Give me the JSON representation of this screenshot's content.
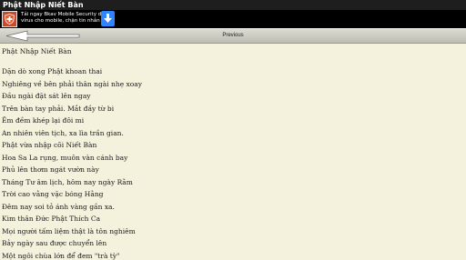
{
  "window": {
    "title": "Phật Nhập Niết Bàn"
  },
  "ad": {
    "icon": "shield-plus-icon",
    "text_line1": "Tải ngay Bkav Mobile Security diệt",
    "text_line2": "virus cho mobile, chặn tin nhắn rác",
    "download_icon": "download-arrow-icon"
  },
  "nav": {
    "back_icon": "back-arrow-icon",
    "previous_label": "Previous"
  },
  "document": {
    "title": "Phật Nhập Niết Bàn",
    "lines": [
      "Dặn dò xong Phật khoan thai",
      "Nghiêng về bên phải thân ngài nhẹ xoay",
      "Đầu ngài đặt sát lên ngay",
      "Trên bàn tay phải. Mắt đầy từ bi",
      "Êm đềm khép lại đôi mi",
      "An nhiên viên tịch, xa lìa trần gian.",
      "Phật vừa nhập cõi Niết Bàn",
      "Hoa Sa La rụng, muôn vàn cánh bay",
      "Phủ lên thơm ngát vườn này",
      "Tháng Tư âm lịch, hôm nay ngày Rằm",
      "Trời cao vằng vặc bóng Hằng",
      "Đêm nay soi tỏ ánh vàng gần xa.",
      "Kim thân Đức Phật Thích Ca",
      "Mọi người tấm liệm thật là tôn nghiêm",
      "Bảy ngày sau được chuyển lên",
      "Một ngôi chùa lớn để đem \"trà tỳ\""
    ]
  }
}
